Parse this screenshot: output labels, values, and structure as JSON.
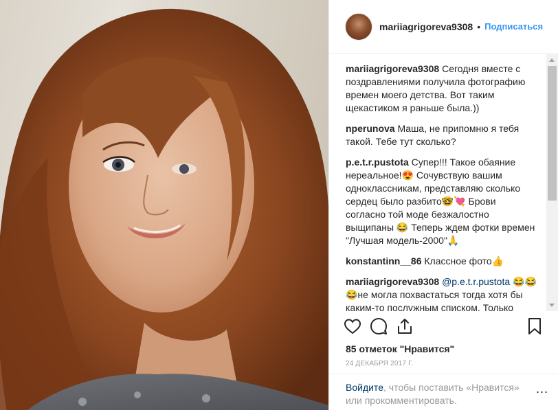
{
  "header": {
    "username": "mariiagrigoreva9308",
    "separator": "•",
    "follow_label": "Подписаться"
  },
  "comments": [
    {
      "author": "mariiagrigoreva9308",
      "text": " Сегодня вместе с поздравлениями получила фотографию времен моего детства. Вот таким щекастиком я раньше была.))"
    },
    {
      "author": "nperunova",
      "text": " Маша, не припомню я тебя такой. Тебе тут сколько?"
    },
    {
      "author": "p.e.t.r.pustota",
      "text": " Супер!!! Такое обаяние нереальное!😍 Сочувствую вашим одноклассникам, представляю сколько сердец было разбито🤓💘 Брови согласно той моде безжалостно выщипаны 😂 Теперь ждем фотки времен \"Лучшая модель-2000\"🙏"
    },
    {
      "author": "konstantinn__86",
      "text": " Классное фото👍"
    },
    {
      "author": "mariiagrigoreva9308",
      "mention": "@p.e.t.r.pustota",
      "text": " 😂😂😂не могла похвастаться тогда хотя бы каким-то послужным списком. Только оценками по учебе. )) Все было чуть позже😂А фото времён моей модельной"
    }
  ],
  "actions": {
    "like_icon": "heart-icon",
    "comment_icon": "comment-icon",
    "share_icon": "share-icon",
    "save_icon": "bookmark-icon"
  },
  "likes_text": "85 отметок \"Нравится\"",
  "date_text": "24 ДЕКАБРЯ 2017 Г.",
  "login_prompt": {
    "link": "Войдите",
    "text": ", чтобы поставить «Нравится» или прокомментировать."
  },
  "more_label": "...",
  "colors": {
    "link_blue": "#3897f0",
    "mention_blue": "#003569",
    "text": "#262626",
    "muted": "#999999"
  }
}
